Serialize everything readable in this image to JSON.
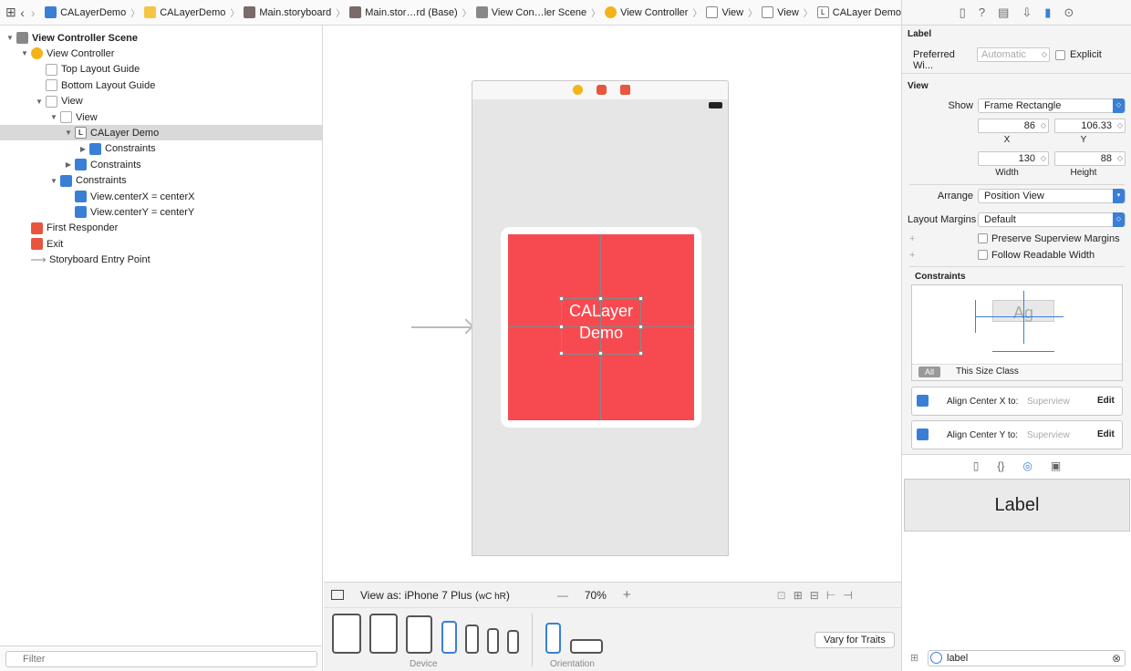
{
  "breadcrumbs": [
    "CALayerDemo",
    "CALayerDemo",
    "Main.storyboard",
    "Main.stor…rd (Base)",
    "View Con…ler Scene",
    "View Controller",
    "View",
    "View",
    "CALayer Demo"
  ],
  "outline": {
    "rows": [
      {
        "label": "View Controller Scene",
        "indent": 0,
        "expanded": true,
        "icon": "scene-icon",
        "bold": true
      },
      {
        "label": "View Controller",
        "indent": 1,
        "expanded": true,
        "icon": "view-controller-icon"
      },
      {
        "label": "Top Layout Guide",
        "indent": 2,
        "icon": "view-icon"
      },
      {
        "label": "Bottom Layout Guide",
        "indent": 2,
        "icon": "view-icon"
      },
      {
        "label": "View",
        "indent": 2,
        "expanded": true,
        "icon": "view-icon"
      },
      {
        "label": "View",
        "indent": 3,
        "expanded": true,
        "icon": "view-icon"
      },
      {
        "label": "CALayer Demo",
        "indent": 4,
        "expanded": true,
        "icon": "label-icon",
        "selected": true
      },
      {
        "label": "Constraints",
        "indent": 5,
        "collapsed": true,
        "icon": "constraints-icon"
      },
      {
        "label": "Constraints",
        "indent": 4,
        "collapsed": true,
        "icon": "constraints-icon"
      },
      {
        "label": "Constraints",
        "indent": 3,
        "expanded": true,
        "icon": "constraints-icon"
      },
      {
        "label": "View.centerX = centerX",
        "indent": 4,
        "icon": "constraint-icon"
      },
      {
        "label": "View.centerY = centerY",
        "indent": 4,
        "icon": "constraint-icon"
      },
      {
        "label": "First Responder",
        "indent": 1,
        "icon": "first-responder-icon"
      },
      {
        "label": "Exit",
        "indent": 1,
        "icon": "exit-icon"
      },
      {
        "label": "Storyboard Entry Point",
        "indent": 1,
        "icon": "entry-arrow-icon"
      }
    ],
    "filter_placeholder": "Filter"
  },
  "canvas": {
    "label_text_line1": "CALayer",
    "label_text_line2": "Demo"
  },
  "viewas": {
    "prefix": "View as: iPhone 7 Plus (",
    "traits": "wC hR",
    "suffix": ")",
    "zoom": "70%",
    "minus": "—",
    "plus": "+"
  },
  "devices": {
    "device_caption": "Device",
    "orientation_caption": "Orientation",
    "vary_button": "Vary for Traits"
  },
  "inspector": {
    "label_section": "Label",
    "preferred_width_label": "Preferred Wi...",
    "preferred_width_placeholder": "Automatic",
    "explicit_label": "Explicit",
    "view_section": "View",
    "show_label": "Show",
    "show_value": "Frame Rectangle",
    "x_value": "86",
    "y_value": "106.33",
    "x_caption": "X",
    "y_caption": "Y",
    "width_value": "130",
    "height_value": "88",
    "width_caption": "Width",
    "height_caption": "Height",
    "arrange_label": "Arrange",
    "arrange_value": "Position View",
    "layout_margins_label": "Layout Margins",
    "layout_margins_value": "Default",
    "preserve_label": "Preserve Superview Margins",
    "readable_label": "Follow Readable Width",
    "constraints_section": "Constraints",
    "preview_text": "Ag",
    "all_tab": "All",
    "size_class_label": "This Size Class",
    "constraint1": "Align Center X to:",
    "constraint2": "Align Center Y to:",
    "superview": "Superview",
    "edit": "Edit"
  },
  "library": {
    "item_label": "Label",
    "filter_value": "label"
  },
  "colors": {
    "accent": "#3a7fd6",
    "red_view": "#f74a50",
    "vc_icon": "#f3b319"
  }
}
